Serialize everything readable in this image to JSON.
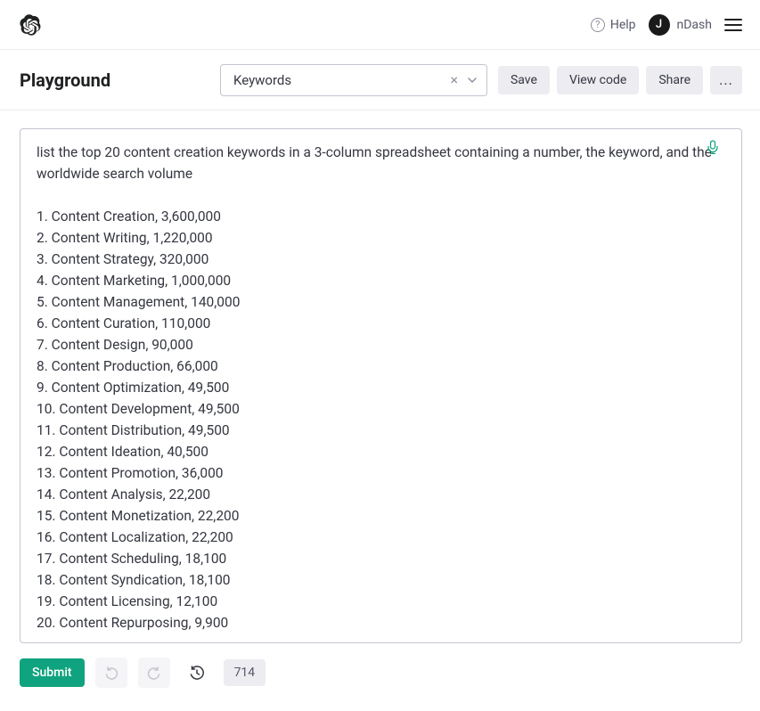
{
  "header": {
    "help_label": "Help",
    "avatar_initial": "J",
    "user_name": "nDash"
  },
  "subheader": {
    "title": "Playground",
    "preset_value": "Keywords",
    "save_label": "Save",
    "view_code_label": "View code",
    "share_label": "Share",
    "more_label": "..."
  },
  "editor": {
    "prompt": "list the top 20 content creation keywords in a 3-column spreadsheet containing a number, the keyword, and the worldwide search volume",
    "items": [
      {
        "n": 1,
        "keyword": "Content Creation",
        "volume": "3,600,000"
      },
      {
        "n": 2,
        "keyword": "Content Writing",
        "volume": "1,220,000"
      },
      {
        "n": 3,
        "keyword": "Content Strategy",
        "volume": "320,000"
      },
      {
        "n": 4,
        "keyword": "Content Marketing",
        "volume": "1,000,000"
      },
      {
        "n": 5,
        "keyword": "Content Management",
        "volume": "140,000"
      },
      {
        "n": 6,
        "keyword": "Content Curation",
        "volume": "110,000"
      },
      {
        "n": 7,
        "keyword": "Content Design",
        "volume": "90,000"
      },
      {
        "n": 8,
        "keyword": "Content Production",
        "volume": "66,000"
      },
      {
        "n": 9,
        "keyword": "Content Optimization",
        "volume": "49,500"
      },
      {
        "n": 10,
        "keyword": "Content Development",
        "volume": "49,500"
      },
      {
        "n": 11,
        "keyword": "Content Distribution",
        "volume": "49,500"
      },
      {
        "n": 12,
        "keyword": "Content Ideation",
        "volume": "40,500"
      },
      {
        "n": 13,
        "keyword": "Content Promotion",
        "volume": "36,000"
      },
      {
        "n": 14,
        "keyword": "Content Analysis",
        "volume": "22,200"
      },
      {
        "n": 15,
        "keyword": "Content Monetization",
        "volume": "22,200"
      },
      {
        "n": 16,
        "keyword": "Content Localization",
        "volume": "22,200"
      },
      {
        "n": 17,
        "keyword": "Content Scheduling",
        "volume": "18,100"
      },
      {
        "n": 18,
        "keyword": "Content Syndication",
        "volume": "18,100"
      },
      {
        "n": 19,
        "keyword": "Content Licensing",
        "volume": "12,100"
      },
      {
        "n": 20,
        "keyword": "Content Repurposing",
        "volume": "9,900"
      }
    ]
  },
  "footer": {
    "submit_label": "Submit",
    "token_count": "714"
  }
}
